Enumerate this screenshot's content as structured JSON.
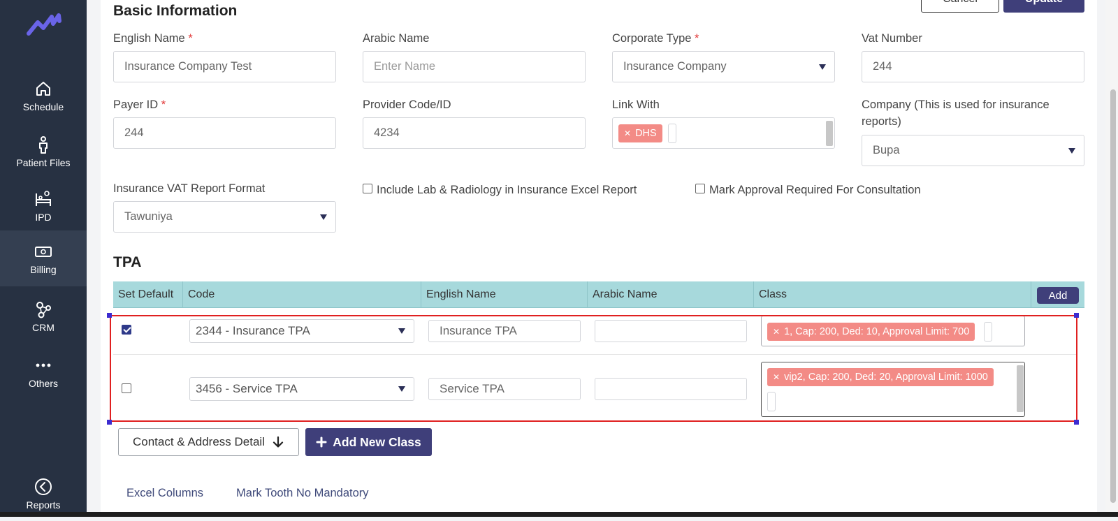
{
  "sidebar": {
    "items": [
      {
        "label": "Schedule",
        "icon": "home-icon"
      },
      {
        "label": "Patient Files",
        "icon": "person-icon"
      },
      {
        "label": "IPD",
        "icon": "bed-icon"
      },
      {
        "label": "Billing",
        "icon": "money-icon"
      },
      {
        "label": "CRM",
        "icon": "network-icon"
      },
      {
        "label": "Others",
        "icon": "dots-icon"
      },
      {
        "label": "Reports",
        "icon": "chevron-left-circle-icon"
      }
    ],
    "active": "Billing"
  },
  "header_buttons": {
    "cancel": "Cancel",
    "update": "Update"
  },
  "basic": {
    "title": "Basic Information",
    "english_name": {
      "label": "English Name",
      "value": "Insurance Company Test"
    },
    "arabic_name": {
      "label": "Arabic Name",
      "placeholder": "Enter Name"
    },
    "corporate_type": {
      "label": "Corporate Type",
      "value": "Insurance Company"
    },
    "vat_number": {
      "label": "Vat Number",
      "value": "244"
    },
    "payer_id": {
      "label": "Payer ID",
      "value": "244"
    },
    "provider_code": {
      "label": "Provider Code/ID",
      "value": "4234"
    },
    "link_with": {
      "label": "Link With",
      "tags": [
        "DHS"
      ]
    },
    "company": {
      "label": "Company (This is used for insurance reports)",
      "value": "Bupa"
    },
    "vat_format": {
      "label": "Insurance VAT Report Format",
      "value": "Tawuniya"
    },
    "include_lab": {
      "label": "Include Lab & Radiology in Insurance Excel Report",
      "checked": false
    },
    "mark_approval": {
      "label": "Mark Approval Required For Consultation",
      "checked": false
    }
  },
  "tpa": {
    "title": "TPA",
    "columns": [
      "Set Default",
      "Code",
      "English Name",
      "Arabic Name",
      "Class"
    ],
    "add_label": "Add",
    "rows": [
      {
        "default": true,
        "code": "2344 - Insurance TPA",
        "english": "Insurance TPA",
        "arabic": "",
        "class_tag": "1, Cap: 200, Ded: 10, Approval Limit: 700"
      },
      {
        "default": false,
        "code": "3456 - Service TPA",
        "english": "Service TPA",
        "arabic": "",
        "class_tag": "vip2, Cap: 200, Ded: 20, Approval Limit: 1000"
      }
    ]
  },
  "actions": {
    "contact": "Contact & Address Detail",
    "add_class": "Add New Class"
  },
  "bottom_tabs": [
    "Excel Columns",
    "Mark Tooth No Mandatory"
  ],
  "colors": {
    "sidebar": "#273142",
    "primary": "#3f3f7a",
    "tag": "#f38b86",
    "table_header": "#a7d9dc"
  }
}
